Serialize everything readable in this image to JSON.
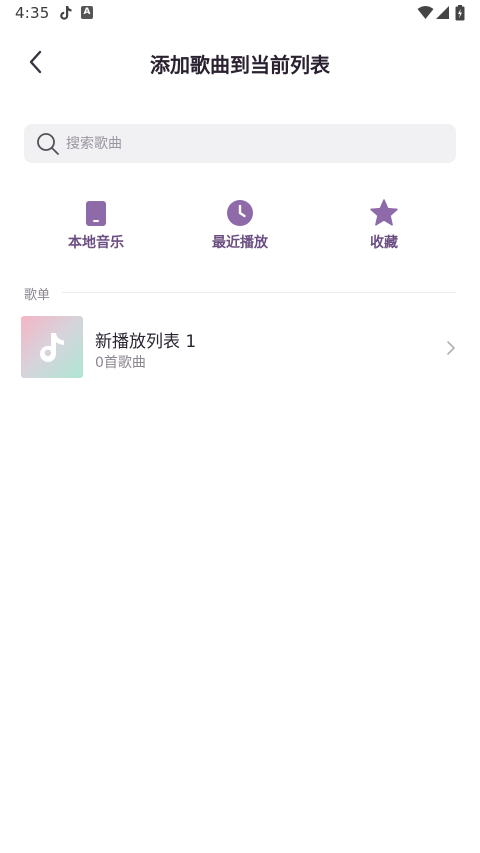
{
  "status_bar": {
    "time": "4:35",
    "icons": [
      "tiktok-icon",
      "a-badge-icon",
      "wifi-icon",
      "signal-icon",
      "battery-icon"
    ],
    "a_badge": "A"
  },
  "header": {
    "title": "添加歌曲到当前列表",
    "back_icon": "chevron-left-icon"
  },
  "search": {
    "placeholder": "搜索歌曲",
    "value": "",
    "icon": "search-icon"
  },
  "quick_actions": [
    {
      "label": "本地音乐",
      "icon": "phone-icon"
    },
    {
      "label": "最近播放",
      "icon": "clock-icon"
    },
    {
      "label": "收藏",
      "icon": "star-icon"
    }
  ],
  "section": {
    "label": "歌单"
  },
  "playlists": [
    {
      "name": "新播放列表 1",
      "count": "0首歌曲",
      "icon": "music-note-icon"
    }
  ],
  "colors": {
    "accent": "#8e6aa8",
    "accent_text": "#6c4f82",
    "search_bg": "#f1f0f3",
    "title": "#2a2130"
  }
}
